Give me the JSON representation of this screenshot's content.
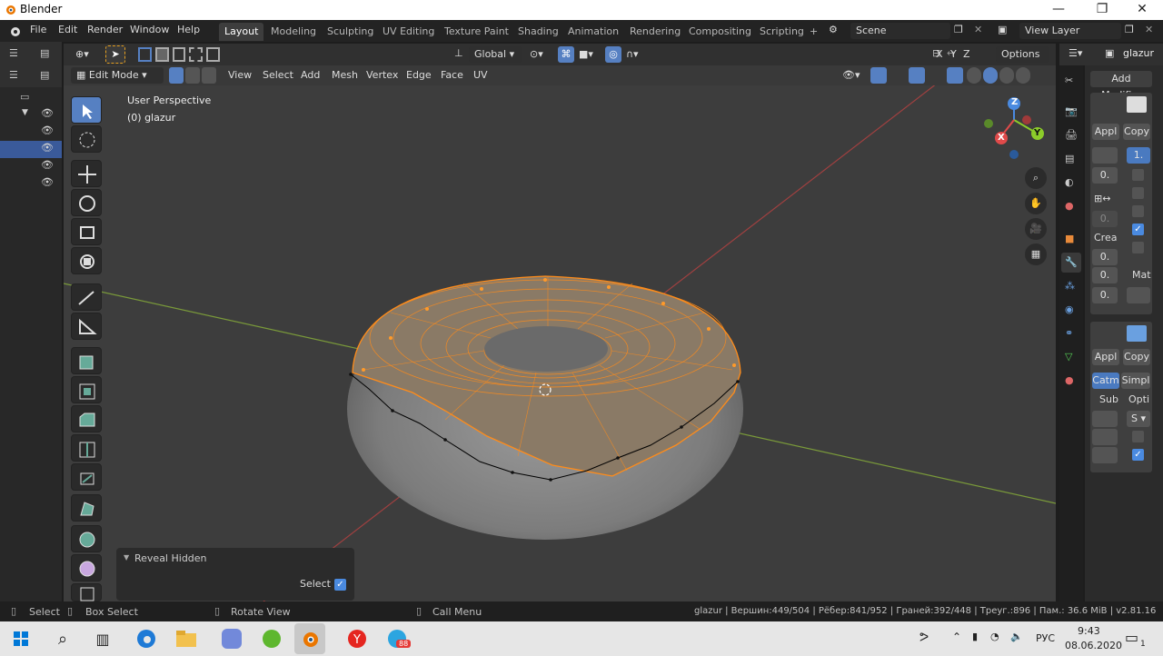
{
  "window": {
    "title": "Blender"
  },
  "menubar": {
    "items": [
      "File",
      "Edit",
      "Render",
      "Window",
      "Help"
    ],
    "tabs": [
      "Layout",
      "Modeling",
      "Sculpting",
      "UV Editing",
      "Texture Paint",
      "Shading",
      "Animation",
      "Rendering",
      "Compositing",
      "Scripting"
    ],
    "active_tab": "Layout",
    "add_tab": "+",
    "scene": "Scene",
    "view_layer": "View Layer"
  },
  "viewport_header": {
    "mode": "Edit Mode",
    "menus": [
      "View",
      "Select",
      "Add",
      "Mesh",
      "Vertex",
      "Edge",
      "Face",
      "UV"
    ],
    "orientation": "Global",
    "options": "Options",
    "axes": [
      "X",
      "Y",
      "Z"
    ]
  },
  "viewport": {
    "view_name": "User Perspective",
    "object_name": "(0) glazur",
    "gizmo_axes": {
      "z": "Z",
      "y": "Y",
      "x": "X"
    }
  },
  "redo_panel": {
    "title": "Reveal Hidden",
    "select_label": "Select",
    "select_checked": true
  },
  "properties": {
    "object_name": "glazur",
    "add_modifier": "Add Modifi...",
    "apply": "Appl",
    "copy": "Copy",
    "value1": "1.",
    "zero": "0.",
    "crea": "Crea",
    "mat": "Mat",
    "apply2": "Appl",
    "copy2": "Copy",
    "catm": "Catm",
    "simpl": "Simpl",
    "sub": "Sub",
    "opti": "Opti",
    "s": "S"
  },
  "statusbar": {
    "select": "Select",
    "box_select": "Box Select",
    "rotate_view": "Rotate View",
    "call_menu": "Call Menu",
    "stats": "glazur | Вершин:449/504 | Рёбер:841/952 | Граней:392/448 | Треуг.:896 | Пам.: 36.6 MiB | v2.81.16"
  },
  "taskbar": {
    "lang": "РУС",
    "time": "9:43",
    "date": "08.06.2020",
    "badge": "88",
    "notif": "1"
  },
  "colors": {
    "accent": "#5680c2",
    "selection_orange": "#ff8c1a",
    "axis_x": "#e04a4a",
    "axis_y": "#8ccc2a",
    "axis_z": "#4a8ae0"
  }
}
